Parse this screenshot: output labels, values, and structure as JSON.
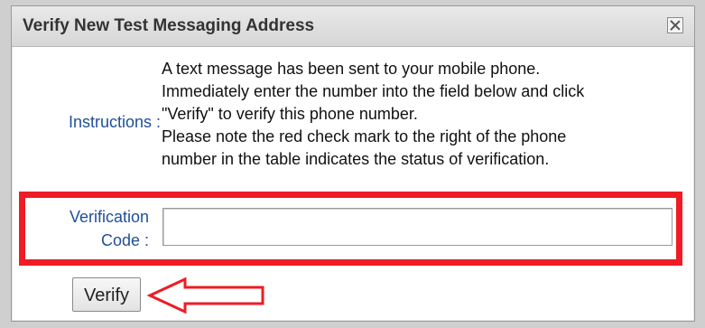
{
  "dialog": {
    "title": "Verify New Test Messaging Address",
    "close_icon": "close-icon"
  },
  "instructions": {
    "label": "Instructions :",
    "lines": [
      "A text message has been sent to your mobile phone.",
      "Immediately enter the number into the field below and click",
      "\"Verify\" to verify this phone number.",
      "Please note the red check mark to the right of the phone",
      "number in the table indicates the status of verification."
    ]
  },
  "verification": {
    "label_line1": "Verification",
    "label_line2": "Code :",
    "value": "",
    "placeholder": ""
  },
  "buttons": {
    "verify_label": "Verify"
  },
  "annotations": {
    "highlight_color": "#ee1c24",
    "arrow_icon": "left-arrow-icon"
  }
}
